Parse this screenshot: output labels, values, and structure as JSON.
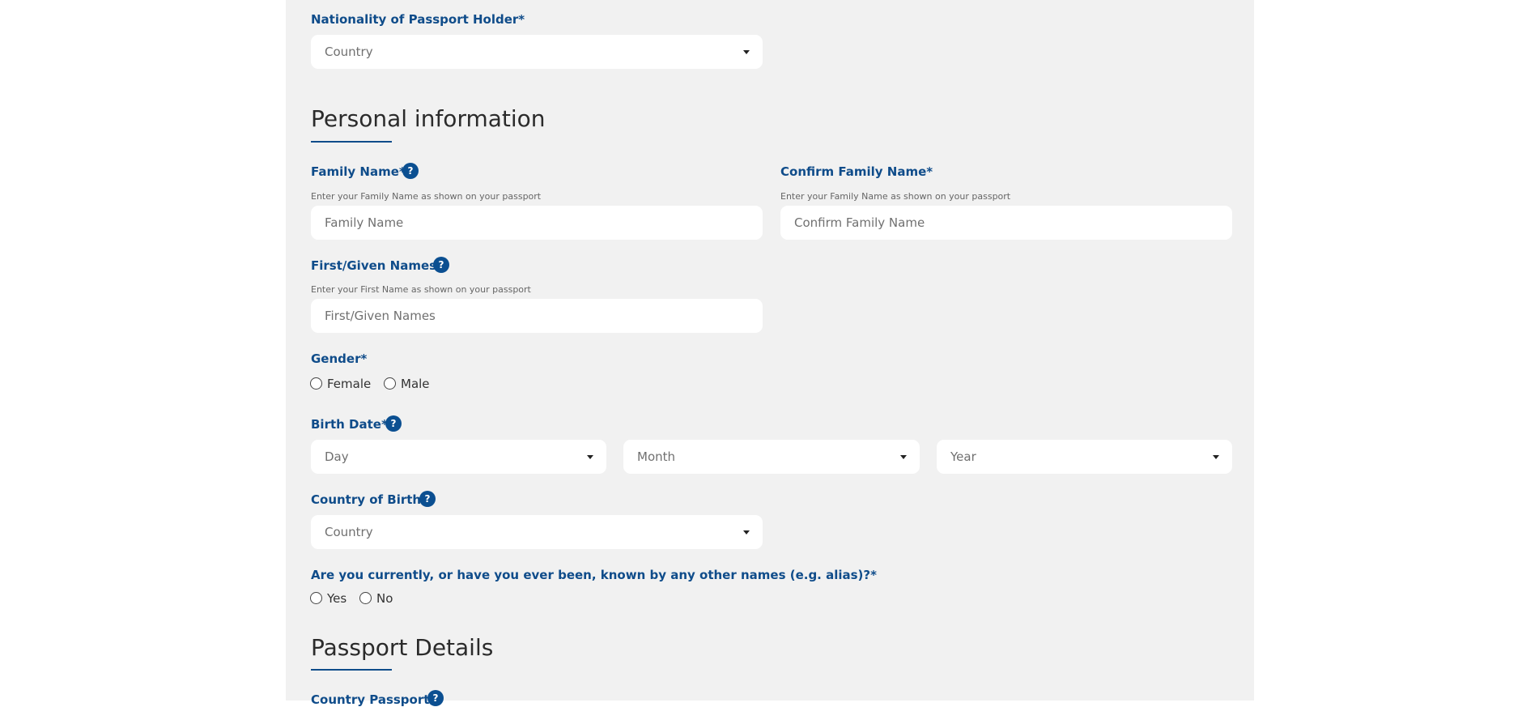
{
  "nationality": {
    "label": "Nationality of Passport Holder*",
    "placeholder": "Country"
  },
  "personal_section": {
    "title": "Personal information"
  },
  "family_name": {
    "label": "Family Name*",
    "hint": "Enter your Family Name as shown on your passport",
    "placeholder": "Family Name",
    "help": "?"
  },
  "confirm_family_name": {
    "label": "Confirm Family Name*",
    "hint": "Enter your Family Name as shown on your passport",
    "placeholder": "Confirm Family Name"
  },
  "first_names": {
    "label": "First/Given Names*",
    "hint": "Enter your First Name as shown on your passport",
    "placeholder": "First/Given Names",
    "help": "?"
  },
  "gender": {
    "label": "Gender*",
    "options": [
      "Female",
      "Male"
    ]
  },
  "birth_date": {
    "label": "Birth Date*",
    "help": "?",
    "day": "Day",
    "month": "Month",
    "year": "Year"
  },
  "country_of_birth": {
    "label": "Country of Birth*",
    "help": "?",
    "placeholder": "Country"
  },
  "alias": {
    "label": "Are you currently, or have you ever been, known by any other names (e.g. alias)?*",
    "options": [
      "Yes",
      "No"
    ]
  },
  "passport_section": {
    "title": "Passport Details"
  },
  "country_passport": {
    "label": "Country Passport*",
    "help": "?"
  },
  "colors": {
    "label_blue": "#0f4c8a",
    "help_blue": "#0b4f91",
    "panel_bg": "#f1f1f1"
  }
}
